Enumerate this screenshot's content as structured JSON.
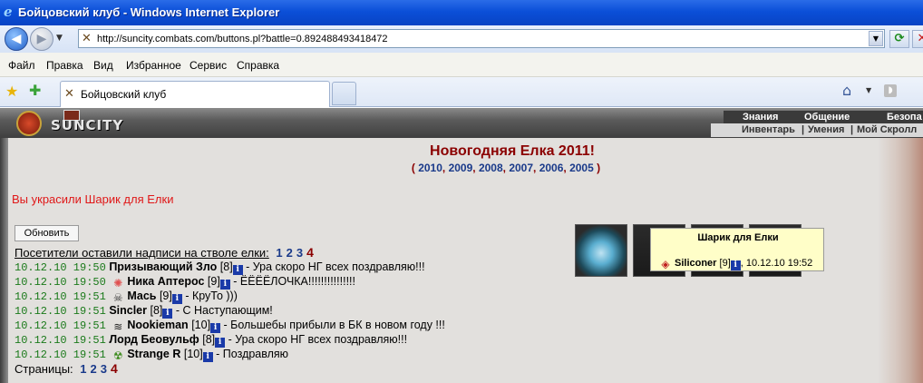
{
  "window": {
    "title": "Бойцовский клуб - Windows Internet Explorer"
  },
  "address": {
    "url": "http://suncity.combats.com/buttons.pl?battle=0.892488493418472"
  },
  "menu": [
    "Файл",
    "Правка",
    "Вид",
    "Избранное",
    "Сервис",
    "Справка"
  ],
  "tab": {
    "label": "Бойцовский клуб"
  },
  "site": {
    "logo": "SUNCITY",
    "nav_top": [
      "Знания",
      "Общение",
      "Безопа"
    ],
    "nav_bottom": [
      "Инвентарь",
      "Умения",
      "Мой Скролл"
    ]
  },
  "page": {
    "title": "Новогодняя Елка 2011!",
    "years": [
      "2010",
      "2009",
      "2008",
      "2007",
      "2006",
      "2005"
    ],
    "message": "Вы украсили Шарик для Елки",
    "refresh_button": "Обновить",
    "visitors_heading": "Посетители оставили надписи на стволе елки:",
    "pages_label": "Страницы:",
    "pages": [
      "1",
      "2",
      "3",
      "4"
    ],
    "current_page": "4"
  },
  "log": [
    {
      "time": "10.12.10 19:50",
      "clan_icon": "",
      "nick": "Призывающий Зло",
      "level": "[8]",
      "text": " - Ура скоро НГ всех поздравляю!!!"
    },
    {
      "time": "10.12.10 19:50",
      "clan_icon": "sunburst-clan-icon",
      "nick": "Ника Аптерос",
      "level": "[9]",
      "text": " - ЁЁЁЁЛОЧКА!!!!!!!!!!!!!!!"
    },
    {
      "time": "10.12.10 19:51",
      "clan_icon": "skull-clan-icon",
      "nick": "Мась",
      "level": "[9]",
      "text": " - КруТо )))"
    },
    {
      "time": "10.12.10 19:51",
      "clan_icon": "",
      "nick": "Sincler",
      "level": "[8]",
      "text": " - С Наступающим!"
    },
    {
      "time": "10.12.10 19:51",
      "clan_icon": "dragon-clan-icon",
      "nick": "Nookieman",
      "level": "[10]",
      "text": " - Большебы прибыли в БК в новом году !!!"
    },
    {
      "time": "10.12.10 19:51",
      "clan_icon": "",
      "nick": "Лорд Беовульф",
      "level": "[8]",
      "text": " - Ура скоро НГ всех поздравляю!!!"
    },
    {
      "time": "10.12.10 19:51",
      "clan_icon": "radiation-clan-icon",
      "nick": "Strange R",
      "level": "[10]",
      "text": " - Поздравляю"
    }
  ],
  "tooltip": {
    "title": "Шарик для Елки",
    "nick": "Siliconer",
    "level": "[9]",
    "date": ", 10.12.10 19:52"
  },
  "colors": {
    "title_red": "#8b0000",
    "link_blue": "#1a3a8a",
    "time_green": "#1a7a1a",
    "message_red": "#e01818"
  }
}
